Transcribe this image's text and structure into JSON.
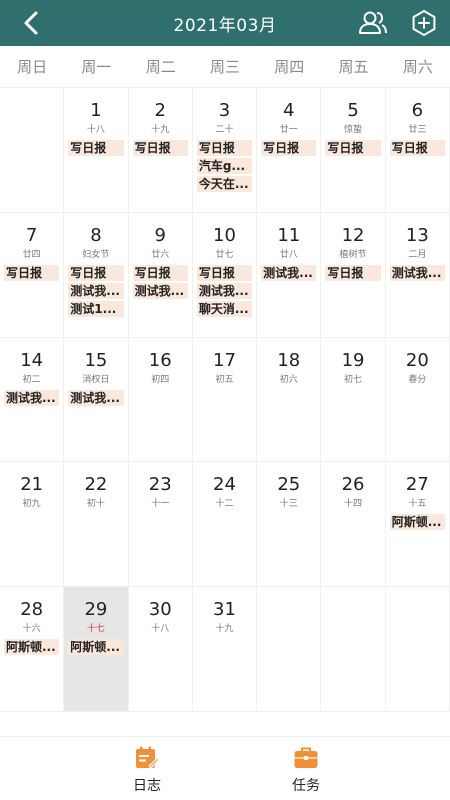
{
  "header": {
    "title": "2021年03月"
  },
  "weekdays": [
    "周日",
    "周一",
    "周二",
    "周三",
    "周四",
    "周五",
    "周六"
  ],
  "days": [
    {
      "num": "",
      "lunar": "",
      "events": []
    },
    {
      "num": "1",
      "lunar": "十八",
      "events": [
        "写日报"
      ]
    },
    {
      "num": "2",
      "lunar": "十九",
      "events": [
        "写日报"
      ]
    },
    {
      "num": "3",
      "lunar": "二十",
      "events": [
        "写日报",
        "汽车g...",
        "今天在..."
      ]
    },
    {
      "num": "4",
      "lunar": "廿一",
      "events": [
        "写日报"
      ]
    },
    {
      "num": "5",
      "lunar": "惊蛰",
      "events": [
        "写日报"
      ]
    },
    {
      "num": "6",
      "lunar": "廿三",
      "events": [
        "写日报"
      ]
    },
    {
      "num": "7",
      "lunar": "廿四",
      "events": [
        "写日报"
      ]
    },
    {
      "num": "8",
      "lunar": "妇女节",
      "events": [
        "写日报",
        "测试我...",
        "测试1..."
      ]
    },
    {
      "num": "9",
      "lunar": "廿六",
      "events": [
        "写日报",
        "测试我..."
      ]
    },
    {
      "num": "10",
      "lunar": "廿七",
      "events": [
        "写日报",
        "测试我...",
        "聊天消..."
      ]
    },
    {
      "num": "11",
      "lunar": "廿八",
      "events": [
        "测试我..."
      ]
    },
    {
      "num": "12",
      "lunar": "植树节",
      "events": [
        "写日报"
      ]
    },
    {
      "num": "13",
      "lunar": "二月",
      "events": [
        "测试我..."
      ]
    },
    {
      "num": "14",
      "lunar": "初二",
      "events": [
        "测试我..."
      ]
    },
    {
      "num": "15",
      "lunar": "消权日",
      "events": [
        "测试我..."
      ]
    },
    {
      "num": "16",
      "lunar": "初四",
      "events": []
    },
    {
      "num": "17",
      "lunar": "初五",
      "events": []
    },
    {
      "num": "18",
      "lunar": "初六",
      "events": []
    },
    {
      "num": "19",
      "lunar": "初七",
      "events": []
    },
    {
      "num": "20",
      "lunar": "春分",
      "events": []
    },
    {
      "num": "21",
      "lunar": "初九",
      "events": []
    },
    {
      "num": "22",
      "lunar": "初十",
      "events": []
    },
    {
      "num": "23",
      "lunar": "十一",
      "events": []
    },
    {
      "num": "24",
      "lunar": "十二",
      "events": []
    },
    {
      "num": "25",
      "lunar": "十三",
      "events": []
    },
    {
      "num": "26",
      "lunar": "十四",
      "events": []
    },
    {
      "num": "27",
      "lunar": "十五",
      "events": [
        "阿斯顿..."
      ]
    },
    {
      "num": "28",
      "lunar": "十六",
      "events": [
        "阿斯顿..."
      ]
    },
    {
      "num": "29",
      "lunar": "十七",
      "events": [
        "阿斯顿..."
      ],
      "today": true
    },
    {
      "num": "30",
      "lunar": "十八",
      "events": []
    },
    {
      "num": "31",
      "lunar": "十九",
      "events": []
    },
    {
      "num": "",
      "lunar": "",
      "events": []
    },
    {
      "num": "",
      "lunar": "",
      "events": []
    },
    {
      "num": "",
      "lunar": "",
      "events": []
    }
  ],
  "tabs": {
    "diary": "日志",
    "task": "任务"
  },
  "colors": {
    "header": "#2f6f6e",
    "event_bg": "#fbe8dc",
    "accent": "#f0913a",
    "today_lunar": "#e23434"
  },
  "icons": {
    "back": "chevron-left-icon",
    "user": "users-icon",
    "add": "plus-circle-icon",
    "diary": "calendar-edit-icon",
    "task": "briefcase-icon"
  }
}
